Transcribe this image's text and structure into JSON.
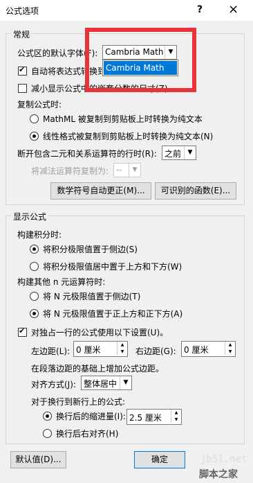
{
  "window": {
    "title": "公式选项",
    "help": "?",
    "close": "×"
  },
  "general": {
    "label": "常规",
    "default_font_label": "公式区的默认字体(F):",
    "default_font_value": "Cambria Math",
    "dropdown_option": "Cambria Math",
    "auto_convert": {
      "label": "自动将表达式转换到专业格式",
      "checked": true
    },
    "reduce_size": {
      "label": "减小显示公式中的嵌套分数的尺寸(Z)",
      "checked": false
    },
    "copy_label": "复制公式时:",
    "copy_options": [
      {
        "label": "MathML 被复制到剪贴板上时转换为纯文本",
        "selected": false
      },
      {
        "label": "线性格式被复制到剪贴板上时转换为纯文本(N)",
        "selected": true
      }
    ],
    "break_label": "断开包含二元和关系运算符的行时(R):",
    "break_value": "之前",
    "dup_label": "将减法运算符复制为:",
    "dup_value": "--",
    "autocorrect_button": "数学符号自动更正(M)...",
    "functions_button": "可识别的函数(E)..."
  },
  "display": {
    "label": "显示公式",
    "integrals_label": "构建积分时:",
    "integral_options": [
      {
        "label": "将积分极限值置于侧边(S)",
        "selected": true
      },
      {
        "label": "将积分极限值居中置于上方和下方(W)",
        "selected": false
      }
    ],
    "nary_label": "构建其他 n 元运算符时:",
    "nary_options": [
      {
        "label": "将 N 元极限值置于侧边(T)",
        "selected": false
      },
      {
        "label": "将 N 元极限值置于正上方和正下方(A)",
        "selected": true
      }
    ],
    "own_line": {
      "label": "对独占一行的公式使用以下设置(U)。",
      "checked": true
    },
    "left_margin_label": "左边距(L):",
    "left_margin_value": "0 厘米",
    "right_margin_label": "右边距(G):",
    "right_margin_value": "0 厘米",
    "margin_note": "在段落边距的基础上增加公式边距。",
    "justify_label": "对齐方式(J):",
    "justify_value": "整体居中",
    "wrap_label": "对于换行到新行上的公式:",
    "wrap_indent_label": "换行后的缩进量(I):",
    "wrap_indent_value": "2.5 厘米",
    "wrap_right_label": "换行后右对齐(H)",
    "wrap_options_selected": "indent"
  },
  "footer": {
    "defaults_button": "默认值(D)...",
    "ok_button": "确定"
  },
  "watermark": {
    "site": "jb51.net",
    "name": "脚本之家"
  },
  "accent": {
    "highlight": "#0078d7",
    "annotation": "#e8333b"
  }
}
